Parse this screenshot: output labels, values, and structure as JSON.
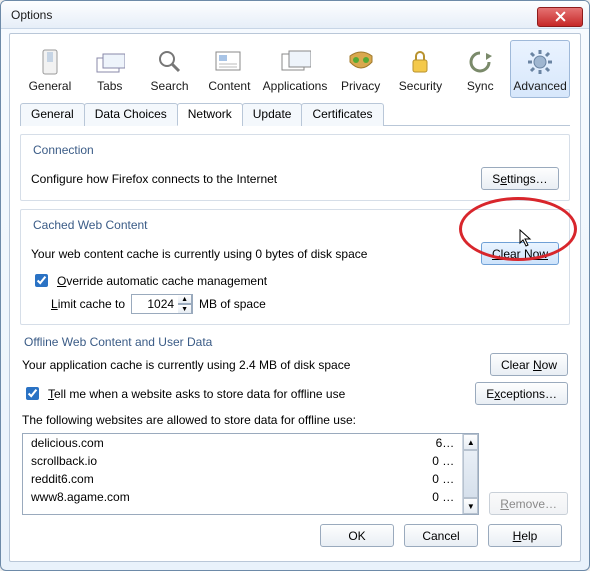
{
  "window": {
    "title": "Options"
  },
  "toolbar": {
    "items": [
      {
        "label": "General"
      },
      {
        "label": "Tabs"
      },
      {
        "label": "Search"
      },
      {
        "label": "Content"
      },
      {
        "label": "Applications"
      },
      {
        "label": "Privacy"
      },
      {
        "label": "Security"
      },
      {
        "label": "Sync"
      },
      {
        "label": "Advanced"
      }
    ]
  },
  "tabs": {
    "items": [
      {
        "label": "General"
      },
      {
        "label": "Data Choices"
      },
      {
        "label": "Network"
      },
      {
        "label": "Update"
      },
      {
        "label": "Certificates"
      }
    ]
  },
  "connection": {
    "legend": "Connection",
    "text": "Configure how Firefox connects to the Internet",
    "settings_btn": "Settings…"
  },
  "cache": {
    "legend": "Cached Web Content",
    "status": "Your web content cache is currently using 0 bytes of disk space",
    "clear_btn": "Clear Now",
    "override_label_pre": "O",
    "override_label_rest": "verride automatic cache management",
    "limit_pre": "L",
    "limit_rest": "imit cache to",
    "limit_value": "1024",
    "limit_unit": "MB of space"
  },
  "offline": {
    "heading": "Offline Web Content and User Data",
    "status": "Your application cache is currently using 2.4 MB of disk space",
    "clear_btn": "Clear Now",
    "tell_pre": "T",
    "tell_rest": "ell me when a website asks to store data for offline use",
    "exceptions_btn": "Exceptions…",
    "list_intro": "The following websites are allowed to store data for offline use:",
    "rows": [
      {
        "site": "delicious.com",
        "size": "6…"
      },
      {
        "site": "scrollback.io",
        "size": "0 …"
      },
      {
        "site": "reddit6.com",
        "size": "0 …"
      },
      {
        "site": "www8.agame.com",
        "size": "0 …"
      }
    ],
    "remove_pre": "R",
    "remove_rest": "emove…"
  },
  "buttons": {
    "ok": "OK",
    "cancel": "Cancel",
    "help_pre": "H",
    "help_rest": "elp"
  }
}
